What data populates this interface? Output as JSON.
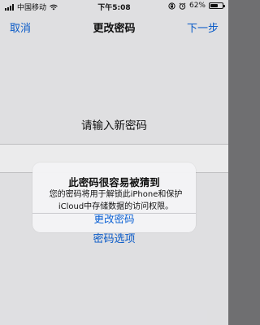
{
  "status_bar": {
    "carrier": "中国移动",
    "time": "下午5:08",
    "battery": "62%",
    "battery_level": 0.62
  },
  "nav": {
    "cancel": "取消",
    "title": "更改密码",
    "next": "下一步"
  },
  "content": {
    "prompt": "请输入新密码",
    "options_link": "密码选项"
  },
  "alert": {
    "title": "此密码很容易被猜到",
    "message": "您的密码将用于解锁此iPhone和保护iCloud中存储数据的访问权限。",
    "button": "更改密码"
  },
  "colors": {
    "accent": "#0a60d4"
  }
}
